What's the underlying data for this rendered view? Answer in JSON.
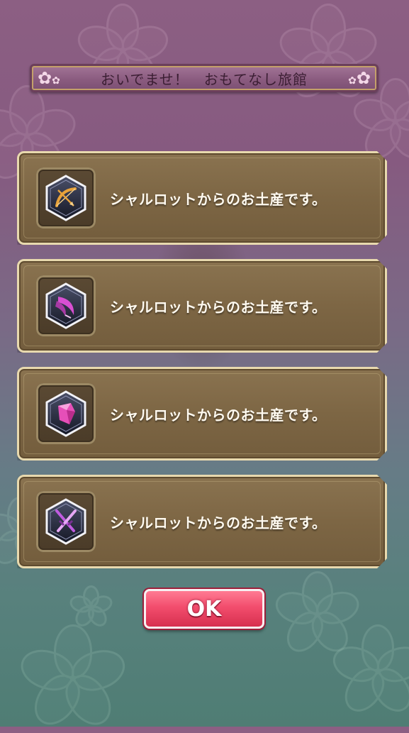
{
  "header": {
    "title": "おいでませ！　おもてなし旅館"
  },
  "gifts": [
    {
      "icon": "bow-arrow-icon",
      "text": "シャルロットからのお土産です。",
      "color": "#e8a23a"
    },
    {
      "icon": "crescent-blade-icon",
      "text": "シャルロットからのお土産です。",
      "color": "#d84fd2"
    },
    {
      "icon": "pink-crystal-icon",
      "text": "シャルロットからのお土産です。",
      "color": "#e64fb8"
    },
    {
      "icon": "crossed-swords-icon",
      "text": "シャルロットからのお土産です。",
      "color": "#c05ce0"
    }
  ],
  "ok_button": {
    "label": "OK"
  },
  "colors": {
    "panel": "#7d6644",
    "panel_border": "#e8d9ae",
    "ok": "#f24d6d"
  }
}
